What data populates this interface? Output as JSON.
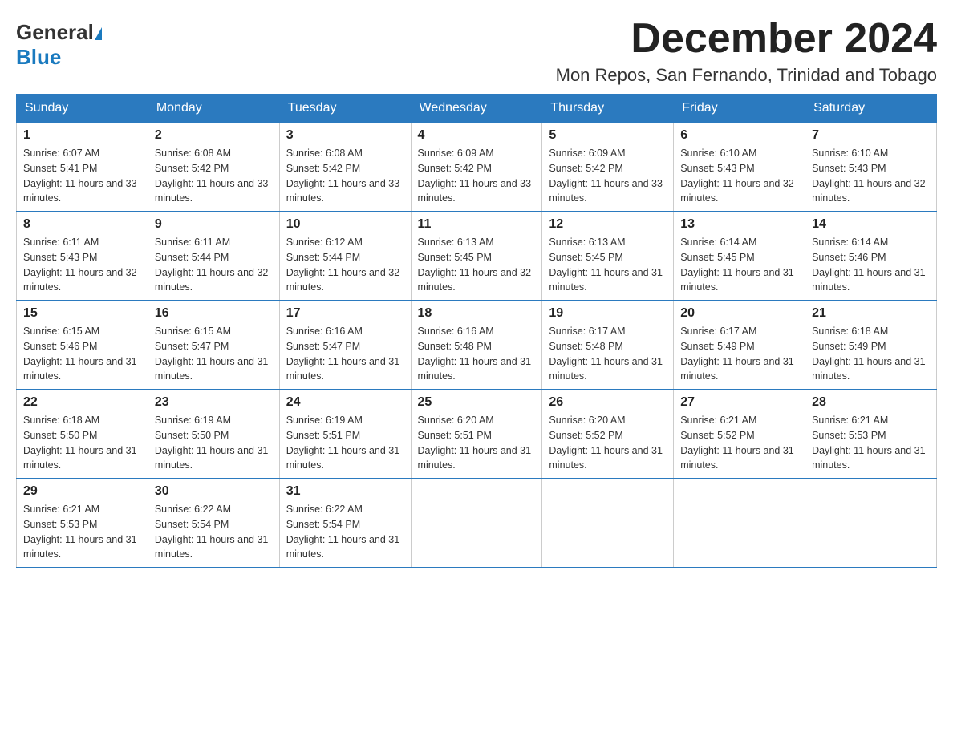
{
  "header": {
    "logo_general": "General",
    "logo_blue": "Blue",
    "month_title": "December 2024",
    "location": "Mon Repos, San Fernando, Trinidad and Tobago"
  },
  "days_of_week": [
    "Sunday",
    "Monday",
    "Tuesday",
    "Wednesday",
    "Thursday",
    "Friday",
    "Saturday"
  ],
  "weeks": [
    [
      {
        "day": "1",
        "sunrise": "6:07 AM",
        "sunset": "5:41 PM",
        "daylight": "11 hours and 33 minutes."
      },
      {
        "day": "2",
        "sunrise": "6:08 AM",
        "sunset": "5:42 PM",
        "daylight": "11 hours and 33 minutes."
      },
      {
        "day": "3",
        "sunrise": "6:08 AM",
        "sunset": "5:42 PM",
        "daylight": "11 hours and 33 minutes."
      },
      {
        "day": "4",
        "sunrise": "6:09 AM",
        "sunset": "5:42 PM",
        "daylight": "11 hours and 33 minutes."
      },
      {
        "day": "5",
        "sunrise": "6:09 AM",
        "sunset": "5:42 PM",
        "daylight": "11 hours and 33 minutes."
      },
      {
        "day": "6",
        "sunrise": "6:10 AM",
        "sunset": "5:43 PM",
        "daylight": "11 hours and 32 minutes."
      },
      {
        "day": "7",
        "sunrise": "6:10 AM",
        "sunset": "5:43 PM",
        "daylight": "11 hours and 32 minutes."
      }
    ],
    [
      {
        "day": "8",
        "sunrise": "6:11 AM",
        "sunset": "5:43 PM",
        "daylight": "11 hours and 32 minutes."
      },
      {
        "day": "9",
        "sunrise": "6:11 AM",
        "sunset": "5:44 PM",
        "daylight": "11 hours and 32 minutes."
      },
      {
        "day": "10",
        "sunrise": "6:12 AM",
        "sunset": "5:44 PM",
        "daylight": "11 hours and 32 minutes."
      },
      {
        "day": "11",
        "sunrise": "6:13 AM",
        "sunset": "5:45 PM",
        "daylight": "11 hours and 32 minutes."
      },
      {
        "day": "12",
        "sunrise": "6:13 AM",
        "sunset": "5:45 PM",
        "daylight": "11 hours and 31 minutes."
      },
      {
        "day": "13",
        "sunrise": "6:14 AM",
        "sunset": "5:45 PM",
        "daylight": "11 hours and 31 minutes."
      },
      {
        "day": "14",
        "sunrise": "6:14 AM",
        "sunset": "5:46 PM",
        "daylight": "11 hours and 31 minutes."
      }
    ],
    [
      {
        "day": "15",
        "sunrise": "6:15 AM",
        "sunset": "5:46 PM",
        "daylight": "11 hours and 31 minutes."
      },
      {
        "day": "16",
        "sunrise": "6:15 AM",
        "sunset": "5:47 PM",
        "daylight": "11 hours and 31 minutes."
      },
      {
        "day": "17",
        "sunrise": "6:16 AM",
        "sunset": "5:47 PM",
        "daylight": "11 hours and 31 minutes."
      },
      {
        "day": "18",
        "sunrise": "6:16 AM",
        "sunset": "5:48 PM",
        "daylight": "11 hours and 31 minutes."
      },
      {
        "day": "19",
        "sunrise": "6:17 AM",
        "sunset": "5:48 PM",
        "daylight": "11 hours and 31 minutes."
      },
      {
        "day": "20",
        "sunrise": "6:17 AM",
        "sunset": "5:49 PM",
        "daylight": "11 hours and 31 minutes."
      },
      {
        "day": "21",
        "sunrise": "6:18 AM",
        "sunset": "5:49 PM",
        "daylight": "11 hours and 31 minutes."
      }
    ],
    [
      {
        "day": "22",
        "sunrise": "6:18 AM",
        "sunset": "5:50 PM",
        "daylight": "11 hours and 31 minutes."
      },
      {
        "day": "23",
        "sunrise": "6:19 AM",
        "sunset": "5:50 PM",
        "daylight": "11 hours and 31 minutes."
      },
      {
        "day": "24",
        "sunrise": "6:19 AM",
        "sunset": "5:51 PM",
        "daylight": "11 hours and 31 minutes."
      },
      {
        "day": "25",
        "sunrise": "6:20 AM",
        "sunset": "5:51 PM",
        "daylight": "11 hours and 31 minutes."
      },
      {
        "day": "26",
        "sunrise": "6:20 AM",
        "sunset": "5:52 PM",
        "daylight": "11 hours and 31 minutes."
      },
      {
        "day": "27",
        "sunrise": "6:21 AM",
        "sunset": "5:52 PM",
        "daylight": "11 hours and 31 minutes."
      },
      {
        "day": "28",
        "sunrise": "6:21 AM",
        "sunset": "5:53 PM",
        "daylight": "11 hours and 31 minutes."
      }
    ],
    [
      {
        "day": "29",
        "sunrise": "6:21 AM",
        "sunset": "5:53 PM",
        "daylight": "11 hours and 31 minutes."
      },
      {
        "day": "30",
        "sunrise": "6:22 AM",
        "sunset": "5:54 PM",
        "daylight": "11 hours and 31 minutes."
      },
      {
        "day": "31",
        "sunrise": "6:22 AM",
        "sunset": "5:54 PM",
        "daylight": "11 hours and 31 minutes."
      },
      null,
      null,
      null,
      null
    ]
  ],
  "labels": {
    "sunrise": "Sunrise: ",
    "sunset": "Sunset: ",
    "daylight": "Daylight: "
  }
}
